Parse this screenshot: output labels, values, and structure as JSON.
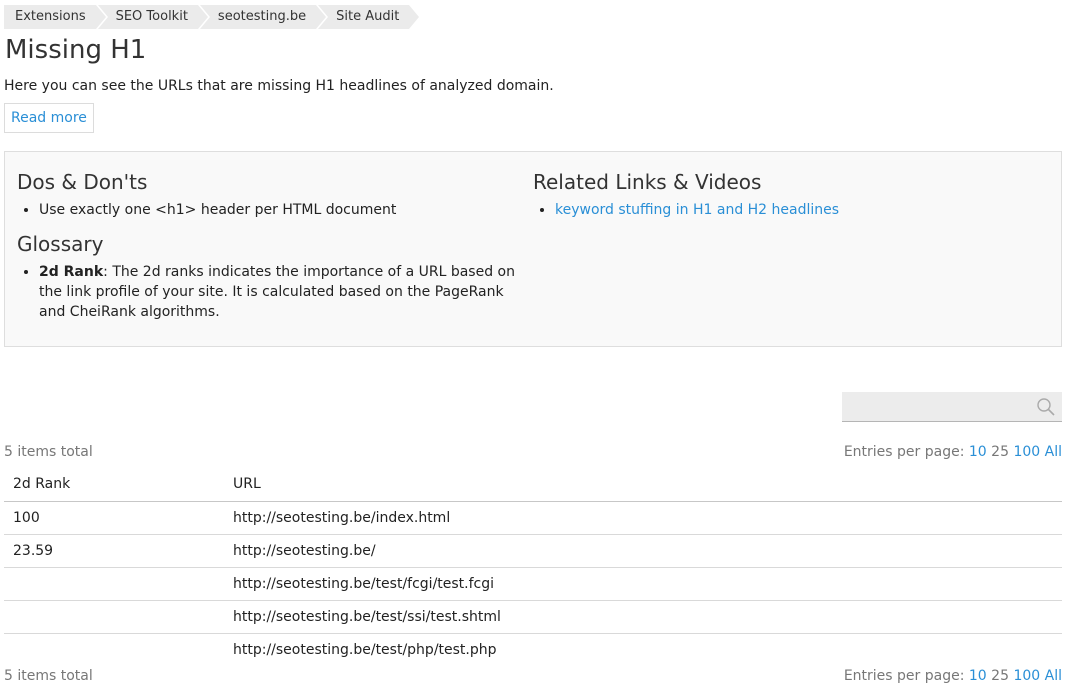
{
  "breadcrumb": [
    "Extensions",
    "SEO Toolkit",
    "seotesting.be",
    "Site Audit"
  ],
  "page": {
    "title": "Missing H1",
    "intro": "Here you can see the URLs that are missing H1 headlines of analyzed domain.",
    "read_more": "Read more"
  },
  "info": {
    "dos_title": "Dos & Don'ts",
    "dos_items": [
      "Use exactly one <h1> header per HTML document"
    ],
    "glossary_title": "Glossary",
    "glossary_term": "2d Rank",
    "glossary_def": ": The 2d ranks indicates the importance of a URL based on the link profile of your site. It is calculated based on the PageRank and CheiRank algorithms.",
    "related_title": "Related Links & Videos",
    "related_links": [
      "keyword stuffing in H1 and H2 headlines"
    ]
  },
  "search": {
    "placeholder": "",
    "value": ""
  },
  "listing": {
    "total_label": "5 items total",
    "entries_label": "Entries per page:",
    "per_page_options": [
      "10",
      "25",
      "100",
      "All"
    ],
    "per_page_selected": "25",
    "columns": [
      "2d Rank",
      "URL"
    ],
    "rows": [
      {
        "rank": "100",
        "url": "http://seotesting.be/index.html"
      },
      {
        "rank": "23.59",
        "url": "http://seotesting.be/"
      },
      {
        "rank": "",
        "url": "http://seotesting.be/test/fcgi/test.fcgi"
      },
      {
        "rank": "",
        "url": "http://seotesting.be/test/ssi/test.shtml"
      },
      {
        "rank": "",
        "url": "http://seotesting.be/test/php/test.php"
      }
    ]
  },
  "colors": {
    "link": "#2a8fd6",
    "muted": "#777777",
    "box_bg": "#f9f9f9"
  }
}
